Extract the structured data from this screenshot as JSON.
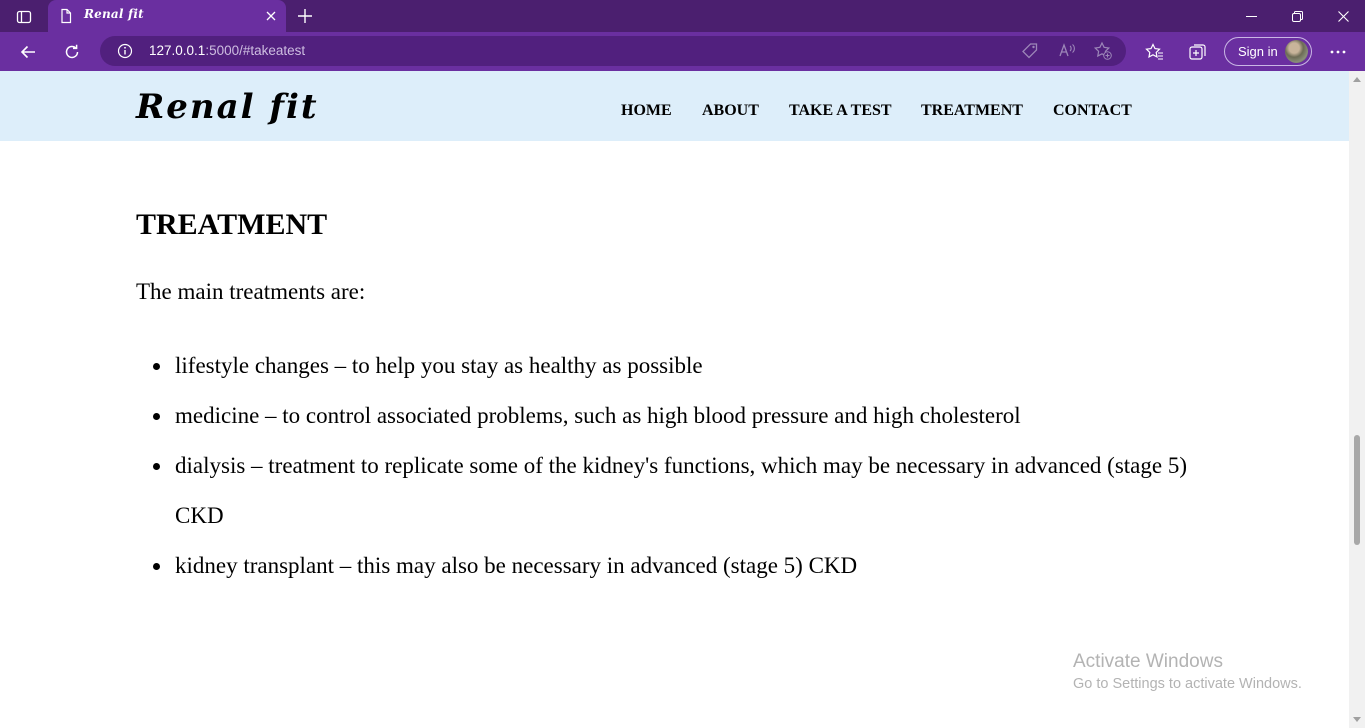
{
  "browser": {
    "tab": {
      "title": "Renal fit",
      "favicon": "document-icon"
    },
    "url": {
      "host": "127.0.0.1",
      "path": ":5000/#takeatest"
    },
    "signin_label": "Sign in",
    "accent_color": "#6a2fa0",
    "tabbar_color": "#4b1f6f"
  },
  "site": {
    "logo": "Renal fit",
    "nav": [
      "HOME",
      "ABOUT",
      "TAKE A TEST",
      "TREATMENT",
      "CONTACT"
    ],
    "header_color": "#ddeefa"
  },
  "content": {
    "title": "TREATMENT",
    "intro": "The main treatments are:",
    "items": [
      "lifestyle changes – to help you stay as healthy as possible",
      "medicine – to control associated problems, such as high blood pressure and high cholesterol",
      "dialysis – treatment to replicate some of the kidney's functions, which may be necessary in advanced (stage 5) CKD",
      "kidney transplant – this may also be necessary in advanced (stage 5) CKD"
    ]
  },
  "watermark": {
    "title": "Activate Windows",
    "subtitle": "Go to Settings to activate Windows."
  }
}
